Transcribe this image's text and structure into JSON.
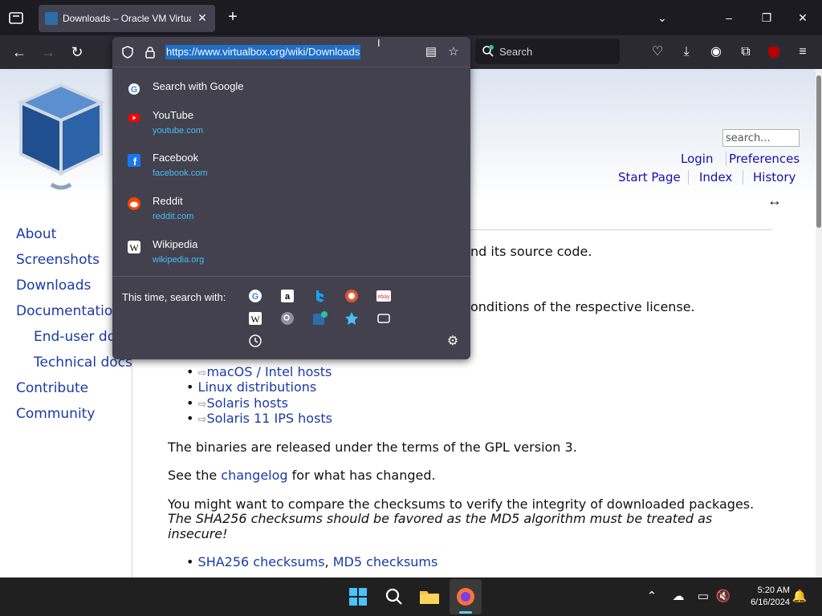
{
  "browser": {
    "tab": {
      "title": "Downloads – Oracle VM VirtualBox"
    },
    "url": "https://www.virtualbox.org/wiki/Downloads",
    "search_placeholder": "Search"
  },
  "url_dropdown": {
    "search_with": "Search with Google",
    "suggestions": [
      {
        "title": "YouTube",
        "url": "youtube.com",
        "icon": "youtube-icon",
        "color": "#ff0000"
      },
      {
        "title": "Facebook",
        "url": "facebook.com",
        "icon": "facebook-icon",
        "color": "#1877f2"
      },
      {
        "title": "Reddit",
        "url": "reddit.com",
        "icon": "reddit-icon",
        "color": "#ff4500"
      },
      {
        "title": "Wikipedia",
        "url": "wikipedia.org",
        "icon": "wikipedia-icon",
        "color": "#ffffff"
      }
    ],
    "this_time": "This time, search with:",
    "engines": [
      "google-icon",
      "amazon-icon",
      "bing-icon",
      "duckduckgo-icon",
      "ebay-icon",
      "wikipedia-icon",
      "magnifier-icon",
      "virtualbox-search-icon",
      "bookmarks-star-icon",
      "tabs-icon",
      "history-icon"
    ]
  },
  "wiki": {
    "search_placeholder": "search...",
    "top_links": [
      "Login",
      "Preferences",
      "Start Page",
      "Index",
      "History"
    ],
    "sidebar": [
      "About",
      "Screenshots",
      "Downloads",
      "Documentation",
      "End-user docs",
      "Technical docs",
      "Contribute",
      "Community"
    ],
    "content": {
      "line1_tail": "nd its source code.",
      "line2_tail": "onditions of the respective license.",
      "hosts": [
        "macOS / Intel hosts",
        "Linux distributions",
        "Solaris hosts",
        "Solaris 11 IPS hosts"
      ],
      "gpl": "The binaries are released under the terms of the GPL version 3.",
      "changelog_pre": "See the ",
      "changelog_link": "changelog",
      "changelog_post": " for what has changed.",
      "checksum_intro": "You might want to compare the checksums to verify the integrity of downloaded packages.",
      "checksum_italic_1": "The SHA256 checksums should be favored as the MD5 algorithm must be treated as",
      "checksum_italic_2": "insecure!",
      "sha_link": "SHA256 checksums",
      "comma": ",",
      "md5_link": "MD5 checksums"
    }
  },
  "taskbar": {
    "time": "5:20 AM",
    "date": "6/16/2024"
  },
  "colors": {
    "accent": "#1e6fc7",
    "link": "#1a3aa8",
    "suggest_url": "#45c0f5"
  }
}
